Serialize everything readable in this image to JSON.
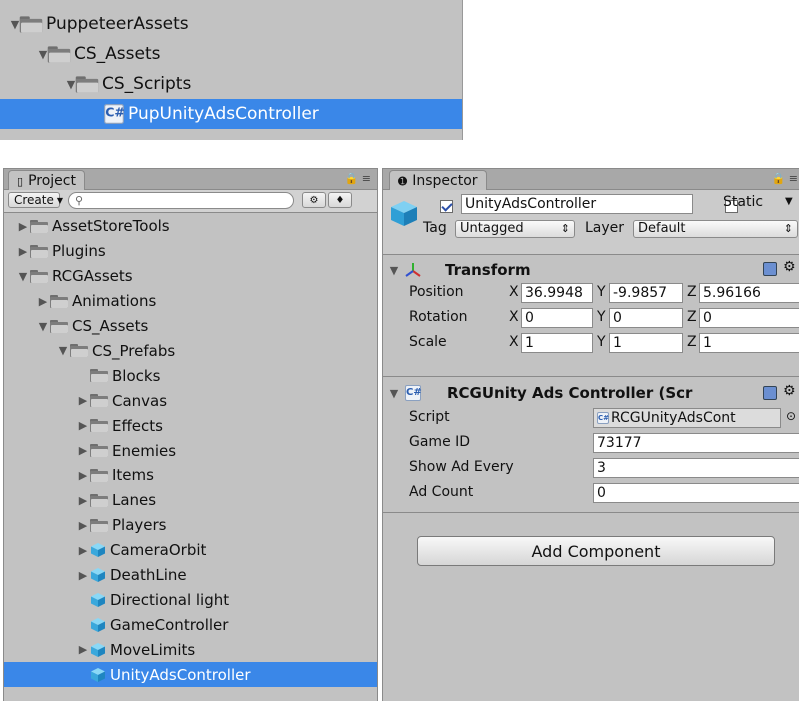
{
  "top_tree": [
    {
      "label": "PuppeteerAssets",
      "indent": 0,
      "arrow": "open",
      "icon": "folder"
    },
    {
      "label": "CS_Assets",
      "indent": 1,
      "arrow": "open",
      "icon": "folder"
    },
    {
      "label": "CS_Scripts",
      "indent": 2,
      "arrow": "open",
      "icon": "folder"
    },
    {
      "label": "PupUnityAdsController",
      "indent": 3,
      "arrow": "none",
      "icon": "script",
      "selected": true
    }
  ],
  "project": {
    "tab_label": "Project",
    "create_label": "Create",
    "search_placeholder": "",
    "tree": [
      {
        "label": "AssetStoreTools",
        "indent": 0,
        "arrow": "closed",
        "icon": "folder"
      },
      {
        "label": "Plugins",
        "indent": 0,
        "arrow": "closed",
        "icon": "folder"
      },
      {
        "label": "RCGAssets",
        "indent": 0,
        "arrow": "open",
        "icon": "folder"
      },
      {
        "label": "Animations",
        "indent": 1,
        "arrow": "closed",
        "icon": "folder"
      },
      {
        "label": "CS_Assets",
        "indent": 1,
        "arrow": "open",
        "icon": "folder"
      },
      {
        "label": "CS_Prefabs",
        "indent": 2,
        "arrow": "open",
        "icon": "folder"
      },
      {
        "label": "Blocks",
        "indent": 3,
        "arrow": "none",
        "icon": "folder"
      },
      {
        "label": "Canvas",
        "indent": 3,
        "arrow": "closed",
        "icon": "folder"
      },
      {
        "label": "Effects",
        "indent": 3,
        "arrow": "closed",
        "icon": "folder"
      },
      {
        "label": "Enemies",
        "indent": 3,
        "arrow": "closed",
        "icon": "folder"
      },
      {
        "label": "Items",
        "indent": 3,
        "arrow": "closed",
        "icon": "folder"
      },
      {
        "label": "Lanes",
        "indent": 3,
        "arrow": "closed",
        "icon": "folder"
      },
      {
        "label": "Players",
        "indent": 3,
        "arrow": "closed",
        "icon": "folder"
      },
      {
        "label": "CameraOrbit",
        "indent": 3,
        "arrow": "closed",
        "icon": "prefab"
      },
      {
        "label": "DeathLine",
        "indent": 3,
        "arrow": "closed",
        "icon": "prefab"
      },
      {
        "label": "Directional light",
        "indent": 3,
        "arrow": "none",
        "icon": "prefab"
      },
      {
        "label": "GameController",
        "indent": 3,
        "arrow": "none",
        "icon": "prefab"
      },
      {
        "label": "MoveLimits",
        "indent": 3,
        "arrow": "closed",
        "icon": "prefab"
      },
      {
        "label": "UnityAdsController",
        "indent": 3,
        "arrow": "none",
        "icon": "prefab",
        "selected": true
      }
    ]
  },
  "inspector": {
    "tab_label": "Inspector",
    "object_name": "UnityAdsController",
    "static_label": "Static",
    "tag_label": "Tag",
    "tag_value": "Untagged",
    "layer_label": "Layer",
    "layer_value": "Default",
    "transform": {
      "title": "Transform",
      "position_label": "Position",
      "rotation_label": "Rotation",
      "scale_label": "Scale",
      "position": {
        "x": "36.9948",
        "y": "-9.9857",
        "z": "5.96166"
      },
      "rotation": {
        "x": "0",
        "y": "0",
        "z": "0"
      },
      "scale": {
        "x": "1",
        "y": "1",
        "z": "1"
      },
      "x": "X",
      "y": "Y",
      "z": "Z"
    },
    "component": {
      "title": "RCGUnity Ads Controller (Scr",
      "script_label": "Script",
      "script_value": "RCGUnityAdsCont",
      "game_id_label": "Game ID",
      "game_id_value": "73177",
      "show_ad_every_label": "Show Ad Every",
      "show_ad_every_value": "3",
      "ad_count_label": "Ad Count",
      "ad_count_value": "0"
    },
    "add_component_label": "Add Component"
  }
}
